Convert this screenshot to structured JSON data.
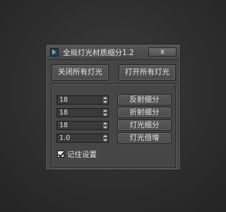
{
  "window": {
    "title": "全局灯光材质细分1.2",
    "close_label": "x",
    "icon": "3dsmax-app-icon"
  },
  "top_buttons": {
    "close_all_lights": "关闭所有灯光",
    "open_all_lights": "打开所有灯光"
  },
  "rows": [
    {
      "value": "18",
      "button": "反射细分"
    },
    {
      "value": "18",
      "button": "折射细分"
    },
    {
      "value": "18",
      "button": "灯光细分"
    },
    {
      "value": "1.0",
      "button": "灯光倍增"
    }
  ],
  "remember": {
    "label": "记住设置",
    "checked": true
  }
}
